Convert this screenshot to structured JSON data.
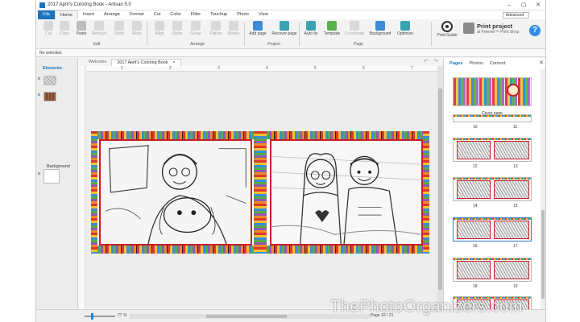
{
  "window": {
    "title": "2017 April's Coloring Book - Artisan 5.0"
  },
  "ribbon_tabs": [
    "File",
    "Home",
    "Insert",
    "Arrange",
    "Format",
    "Cut",
    "Color",
    "Filter",
    "Touchup",
    "Photo",
    "View"
  ],
  "mode": "Advanced",
  "toolbar": {
    "edit": [
      "Cut",
      "Copy",
      "Paste",
      "Remove",
      "Undo",
      "Redo"
    ],
    "arrange": [
      "Align",
      "Order",
      "Group",
      "Flatten",
      "Rotate"
    ],
    "project": [
      "Add page",
      "Recover page"
    ],
    "page": [
      "Auto fix",
      "Template",
      "Coordinate",
      "Background",
      "Optimize"
    ],
    "groups": {
      "edit": "Edit",
      "arrange": "Arrange",
      "project": "Project",
      "page": "Page"
    },
    "print_guide": "Print Guide",
    "print_project_title": "Print project",
    "print_project_sub": "at Forever™ Print Shop",
    "help": "?"
  },
  "infobar": "No selection",
  "left_panel": {
    "tab": "Elements",
    "background_label": "Background"
  },
  "doc_tabs": {
    "welcome": "Welcome",
    "active": "2017 April's Coloring Book",
    "close": "×"
  },
  "ruler_marks": [
    "1",
    "2",
    "3",
    "4",
    "5",
    "6",
    "7"
  ],
  "right_panel": {
    "tabs": [
      "Pages",
      "Photos",
      "Content"
    ],
    "cover_caption": "Cover page",
    "page_numbers": [
      "10",
      "11",
      "12",
      "13",
      "14",
      "15",
      "16",
      "17",
      "18",
      "19",
      "20",
      "21"
    ]
  },
  "status": {
    "zoom": "77 %",
    "page": "Page 16 / 21"
  },
  "watermark": "ThePhotoOrganizers.com"
}
